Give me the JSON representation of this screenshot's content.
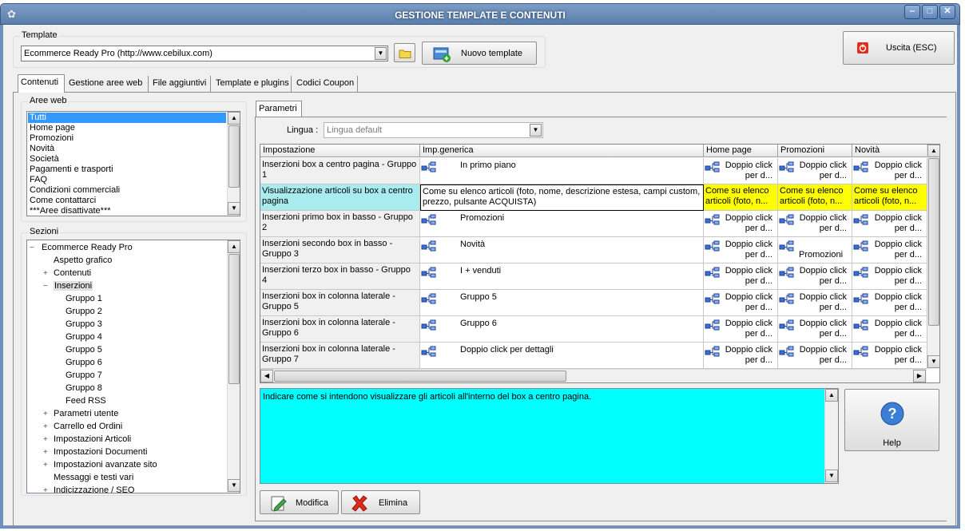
{
  "window": {
    "title": "GESTIONE TEMPLATE E CONTENUTI",
    "minimize": "‒",
    "maximize": "□",
    "close": "✕"
  },
  "template": {
    "legend": "Template",
    "value": "Ecommerce Ready Pro (http://www.cebilux.com)",
    "new_button": "Nuovo template",
    "exit_button": "Uscita (ESC)"
  },
  "tabs": [
    "Contenuti",
    "Gestione aree web",
    "File aggiuntivi",
    "Template e plugins",
    "Codici Coupon"
  ],
  "aree_web": {
    "legend": "Aree web",
    "items": [
      "Tutti",
      "Home page",
      "Promozioni",
      "Novità",
      "Società",
      "Pagamenti e trasporti",
      "FAQ",
      "Condizioni commerciali",
      "Come contattarci",
      "***Aree disattivate***"
    ]
  },
  "sezioni": {
    "legend": "Sezioni",
    "nodes": [
      "Ecommerce Ready Pro",
      "Aspetto grafico",
      "Contenuti",
      "Inserzioni",
      "Gruppo 1",
      "Gruppo 2",
      "Gruppo 3",
      "Gruppo 4",
      "Gruppo 5",
      "Gruppo 6",
      "Gruppo 7",
      "Gruppo 8",
      "Feed RSS",
      "Parametri utente",
      "Carrello ed Ordini",
      "Impostazioni Articoli",
      "Impostazioni Documenti",
      "Impostazioni avanzate sito",
      "Messaggi e testi vari",
      "Indicizzazione / SEO"
    ]
  },
  "parametri": {
    "tab": "Parametri",
    "lingua_label": "Lingua :",
    "lingua_value": "Lingua default"
  },
  "grid": {
    "headers": [
      "Impostazione",
      "Imp.generica",
      "Home page",
      "Promozioni",
      "Novità"
    ],
    "rows": [
      {
        "label": "Inserzioni box a centro pagina - Gruppo 1",
        "generic": "In primo piano",
        "cells": [
          "Doppio click per d...",
          "Doppio click per d...",
          "Doppio click per d..."
        ]
      },
      {
        "label": "Visualizzazione articoli su box a centro pagina",
        "generic": "Come su elenco articoli (foto, nome, descrizione estesa, campi custom, prezzo, pulsante ACQUISTA)",
        "cells": [
          "Come su elenco articoli (foto, n...",
          "Come su elenco articoli (foto, n...",
          "Come su elenco articoli (foto, n..."
        ]
      },
      {
        "label": "Inserzioni primo box in basso - Gruppo 2",
        "generic": "Promozioni",
        "cells": [
          "Doppio click per d...",
          "Doppio click per d...",
          "Doppio click per d..."
        ]
      },
      {
        "label": "Inserzioni secondo box in basso - Gruppo 3",
        "generic": "Novità",
        "cells": [
          "Doppio click per d...",
          "Promozioni",
          "Doppio click per d..."
        ]
      },
      {
        "label": "Inserzioni terzo box in basso - Gruppo 4",
        "generic": "I + venduti",
        "cells": [
          "Doppio click per d...",
          "Doppio click per d...",
          "Doppio click per d..."
        ]
      },
      {
        "label": "Inserzioni box in colonna laterale - Gruppo 5",
        "generic": "Gruppo 5",
        "cells": [
          "Doppio click per d...",
          "Doppio click per d...",
          "Doppio click per d..."
        ]
      },
      {
        "label": "Inserzioni box in colonna laterale - Gruppo 6",
        "generic": "Gruppo 6",
        "cells": [
          "Doppio click per d...",
          "Doppio click per d...",
          "Doppio click per d..."
        ]
      },
      {
        "label": "Inserzioni box in colonna laterale - Gruppo 7",
        "generic": "Doppio click per dettagli",
        "cells": [
          "Doppio click per d...",
          "Doppio click per d...",
          "Doppio click per d..."
        ]
      }
    ]
  },
  "description": "Indicare come si intendono visualizzare gli articoli all'interno del box a centro pagina.",
  "help_button": "Help",
  "modifica_button": "Modifica",
  "elimina_button": "Elimina",
  "colors": {
    "title_bar": "#6b8cb8",
    "highlight": "#a8ecf0",
    "yellow": "#ffff00",
    "description_bg": "#00ffff",
    "selection": "#3399ff"
  }
}
